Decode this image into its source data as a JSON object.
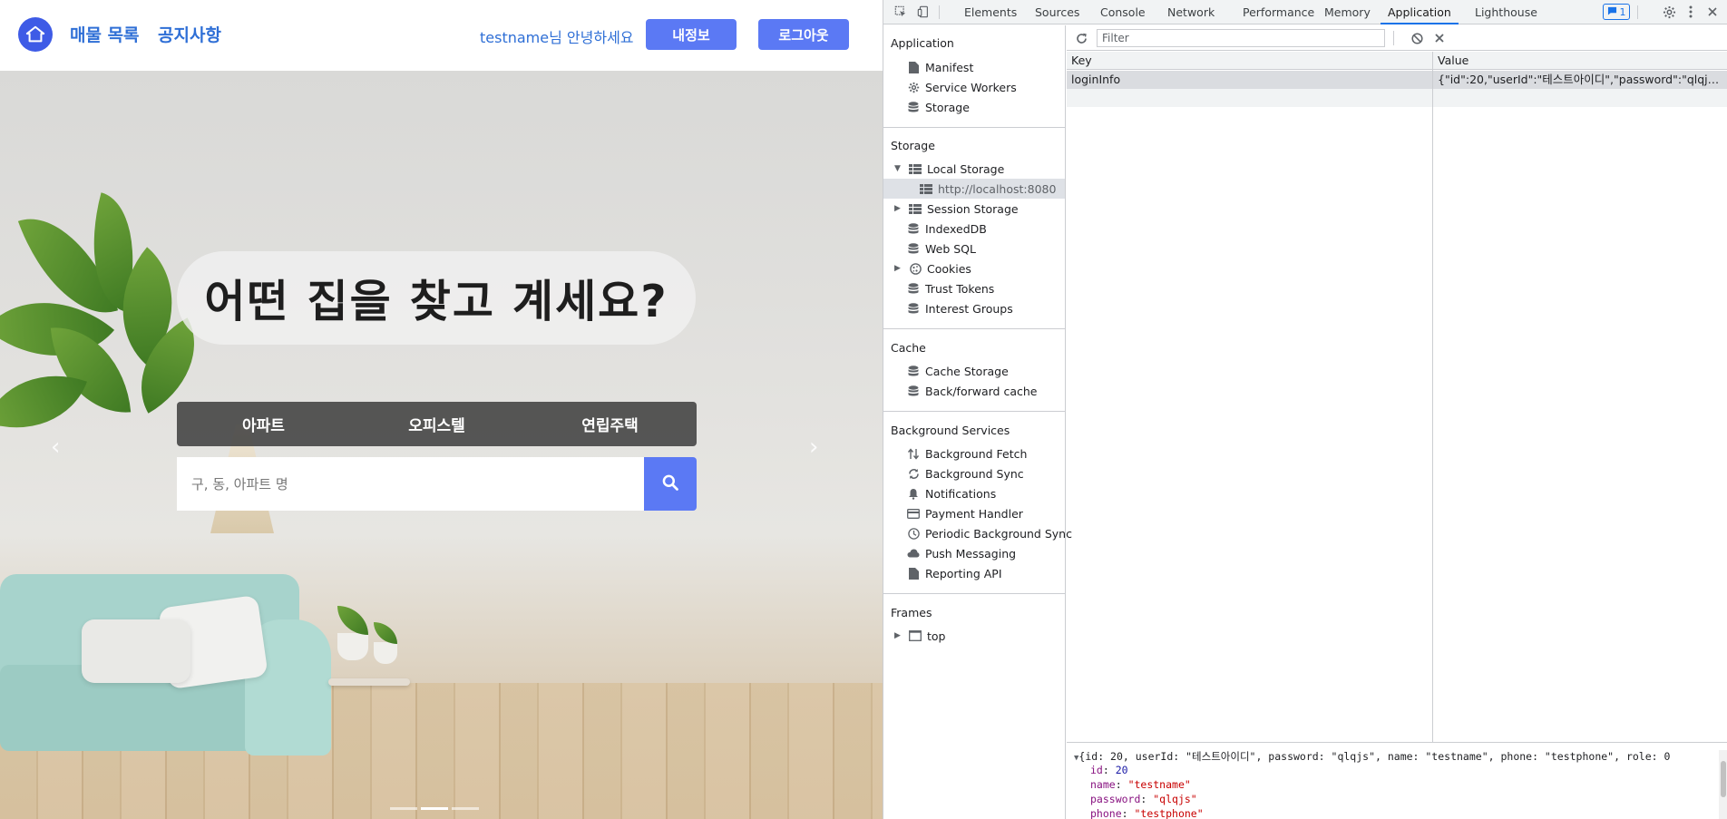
{
  "site": {
    "nav": {
      "listings": "매물 목록",
      "notices": "공지사항",
      "greeting_user": "testname",
      "greeting_suffix": "님 안녕하세요",
      "myinfo_button": "내정보",
      "logout_button": "로그아웃"
    },
    "hero": {
      "title": "어떤 집을 찾고 계세요?",
      "tabs": [
        "아파트",
        "오피스텔",
        "연립주택"
      ],
      "search_placeholder": "구, 동, 아파트 명",
      "prev_arrow": "‹",
      "next_arrow": "›"
    }
  },
  "devtools": {
    "tabs": [
      "Elements",
      "Sources",
      "Console",
      "Network",
      "Performance",
      "Memory",
      "Application",
      "Lighthouse"
    ],
    "active_tab": "Application",
    "issues_count": "1",
    "sidebar": {
      "application_header": "Application",
      "application_items": [
        "Manifest",
        "Service Workers",
        "Storage"
      ],
      "storage_header": "Storage",
      "local_storage": "Local Storage",
      "local_storage_origin": "http://localhost:8080",
      "storage_items": [
        "Session Storage",
        "IndexedDB",
        "Web SQL",
        "Cookies",
        "Trust Tokens",
        "Interest Groups"
      ],
      "cache_header": "Cache",
      "cache_items": [
        "Cache Storage",
        "Back/forward cache"
      ],
      "bg_header": "Background Services",
      "bg_items": [
        "Background Fetch",
        "Background Sync",
        "Notifications",
        "Payment Handler",
        "Periodic Background Sync",
        "Push Messaging",
        "Reporting API"
      ],
      "frames_header": "Frames",
      "frames_top": "top"
    },
    "storage_table": {
      "filter_placeholder": "Filter",
      "headers": [
        "Key",
        "Value"
      ],
      "rows": [
        {
          "key": "loginInfo",
          "value": "{\"id\":20,\"userId\":\"테스트아이디\",\"password\":\"qlqjs..."
        }
      ]
    },
    "preview": {
      "summary": "{id: 20, userId: \"테스트아이디\", password: \"qlqjs\", name: \"testname\", phone: \"testphone\", role: 0",
      "fields": [
        {
          "key": "id",
          "value": "20",
          "type": "num"
        },
        {
          "key": "name",
          "value": "\"testname\"",
          "type": "str"
        },
        {
          "key": "password",
          "value": "\"qlqjs\"",
          "type": "str"
        },
        {
          "key": "phone",
          "value": "\"testphone\"",
          "type": "str"
        }
      ]
    },
    "colors": {
      "accent": "#1a73e8",
      "site_primary": "#5b79f4",
      "site_link": "#2f6fd6"
    }
  }
}
